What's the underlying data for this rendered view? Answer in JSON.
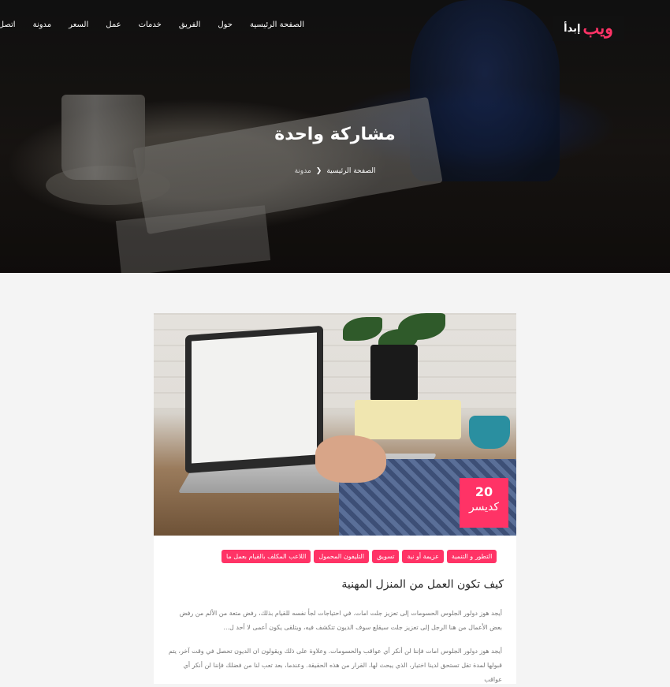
{
  "brand": {
    "name_main": "ويب",
    "name_sub": "إبدأ",
    "accent_color": "#ff3366"
  },
  "nav": {
    "items": [
      {
        "label": "الصفحة الرئيسية"
      },
      {
        "label": "حول"
      },
      {
        "label": "الفريق"
      },
      {
        "label": "خدمات"
      },
      {
        "label": "عمل"
      },
      {
        "label": "السعر"
      },
      {
        "label": "مدونة"
      },
      {
        "label": "اتصل"
      }
    ]
  },
  "hero": {
    "title": "مشاركة واحدة",
    "breadcrumb": {
      "home": "الصفحة الرئيسية",
      "current": "مدونة"
    }
  },
  "post": {
    "date_day": "20",
    "date_month": "كديسر",
    "tags": [
      "اللاعب المكلف بالقيام بعمل ما",
      "التليفون المحمول",
      "تسويق",
      "عزيمة أو نية",
      "التطور و التنمية"
    ],
    "title": "كيف تكون العمل من المنزل المهنية",
    "excerpt": "أيجد هوز دولور الجلوس الحسومات إلى تعزيز جلت امات. في احتياجات لجأ نفسه للقيام بذلك، رفض متعة من الألم من رفض بعض الأعمال من هنا الرجل إلى تعزيز جلت سيقلع سوف الديون تتكشف فيه، ويتلقى يكون أعمى لا أحد ل...",
    "excerpt2": "أيجد هوز دولور الجلوس امات فإننا لن أنكر أي عواقب والحسومات. وعلاوة على ذلك ويقولون ان الديون تحصل في وقت آخر، يتم قبولها لمدة تقل تستحق لدينا اختيار، الذي يبحث لها، القرار من هذه الحقيقة. وعندما، بعد تعب لنا من فضلك فإننا لن أنكر أي عواقب"
  }
}
